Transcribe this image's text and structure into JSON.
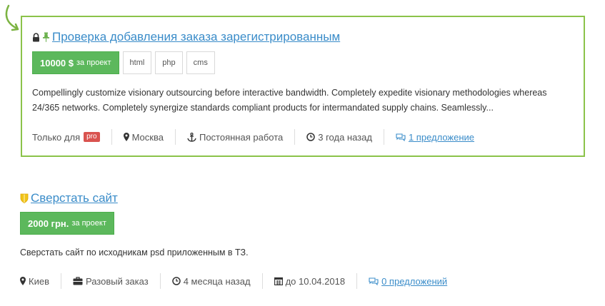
{
  "colors": {
    "accent_green": "#5cb85c",
    "card_border": "#8bc34a",
    "link_blue": "#3a8cc9",
    "pro_red": "#d9534f",
    "shield_yellow": "#f0c419"
  },
  "projects": [
    {
      "icons": [
        "lock-icon",
        "pin-icon"
      ],
      "title": "Проверка добавления заказа зарегистрированным",
      "price_amount": "10000 $",
      "price_unit": "за проект",
      "skills": [
        "html",
        "php",
        "cms"
      ],
      "description": "Compellingly customize visionary outsourcing before interactive bandwidth. Completely expedite visionary methodologies whereas 24/365 networks. Completely synergize standards compliant products for intermandated supply chains. Seamlessly...",
      "only_for": "Только для",
      "pro_badge": "pro",
      "location": "Москва",
      "work_type": "Постоянная работа",
      "posted": "3 года назад",
      "offers": "1 предложение"
    },
    {
      "icons": [
        "shield-icon"
      ],
      "title": "Сверстать сайт",
      "price_amount": "2000 грн.",
      "price_unit": "за проект",
      "description": "Сверстать сайт по исходникам psd приложенным в ТЗ.",
      "location": "Киев",
      "work_type": "Разовый заказ",
      "posted": "4 месяца назад",
      "deadline": "до 10.04.2018",
      "offers": "0 предложений"
    }
  ]
}
